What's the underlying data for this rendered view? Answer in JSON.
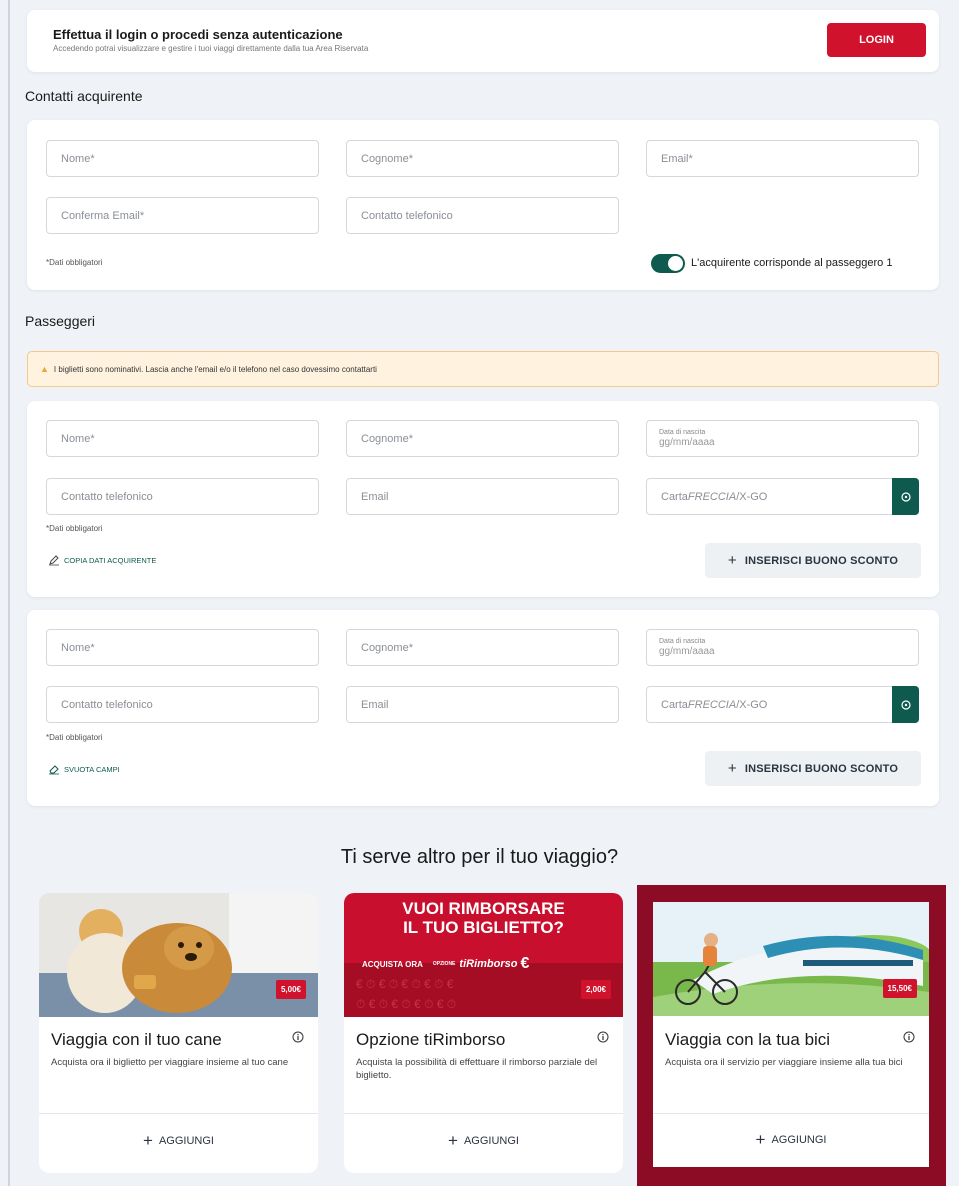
{
  "login": {
    "title": "Effettua il login o procedi senza autenticazione",
    "subtitle": "Accedendo potrai visualizzare e gestire i tuoi viaggi direttamente dalla tua Area Riservata",
    "button": "LOGIN"
  },
  "buyer": {
    "section_title": "Contatti acquirente",
    "fields": {
      "nome": "Nome*",
      "cognome": "Cognome*",
      "email": "Email*",
      "conferma_email": "Conferma Email*",
      "telefono": "Contatto telefonico"
    },
    "required_note": "*Dati obbligatori",
    "toggle_label": "L'acquirente corrisponde al passeggero 1",
    "toggle_on": true
  },
  "passengers": {
    "section_title": "Passeggeri",
    "warning": "I biglietti sono nominativi. Lascia anche l'email e/o il telefono nel caso dovessimo contattarti",
    "list": [
      {
        "nome": "Nome*",
        "cognome": "Cognome*",
        "date_label": "Data di nascita",
        "date_placeholder": "gg/mm/aaaa",
        "telefono": "Contatto telefonico",
        "email": "Email",
        "carta_prefix": "Carta",
        "carta_italic": "FRECCIA",
        "carta_suffix": "/X-GO",
        "required_note": "*Dati obbligatori",
        "action": "COPIA DATI ACQUIRENTE",
        "discount": "INSERISCI BUONO SCONTO"
      },
      {
        "nome": "Nome*",
        "cognome": "Cognome*",
        "date_label": "Data di nascita",
        "date_placeholder": "gg/mm/aaaa",
        "telefono": "Contatto telefonico",
        "email": "Email",
        "carta_prefix": "Carta",
        "carta_italic": "FRECCIA",
        "carta_suffix": "/X-GO",
        "required_note": "*Dati obbligatori",
        "action": "SVUOTA CAMPI",
        "discount": "INSERISCI BUONO SCONTO"
      }
    ]
  },
  "extras": {
    "title": "Ti serve altro per il tuo viaggio?",
    "cards": [
      {
        "title": "Viaggia con il tuo cane",
        "description": "Acquista ora il biglietto per viaggiare insieme al tuo cane",
        "price": "5,00€",
        "add_label": "AGGIUNGI",
        "selected": false
      },
      {
        "title": "Opzione tiRimborso",
        "description": "Acquista la possibilità di effettuare il rimborso parziale del biglietto.",
        "price": "2,00€",
        "add_label": "AGGIUNGI",
        "selected": false,
        "banner_line1": "VUOI RIMBORSARE",
        "banner_line2": "IL TUO BIGLIETTO?",
        "banner_small": "ACQUISTA ORA",
        "banner_opt": "OPZIONE",
        "banner_brand": "tiRimborso"
      },
      {
        "title": "Viaggia con la tua bici",
        "description": "Acquista ora il servizio per viaggiare insieme alla tua bici",
        "price": "15,50€",
        "add_label": "AGGIUNGI",
        "selected": true
      }
    ]
  },
  "colors": {
    "accent_red": "#d1122c",
    "teal": "#0f5a4f",
    "selected_frame": "#8c0b25",
    "warning_bg": "#fff3df"
  }
}
